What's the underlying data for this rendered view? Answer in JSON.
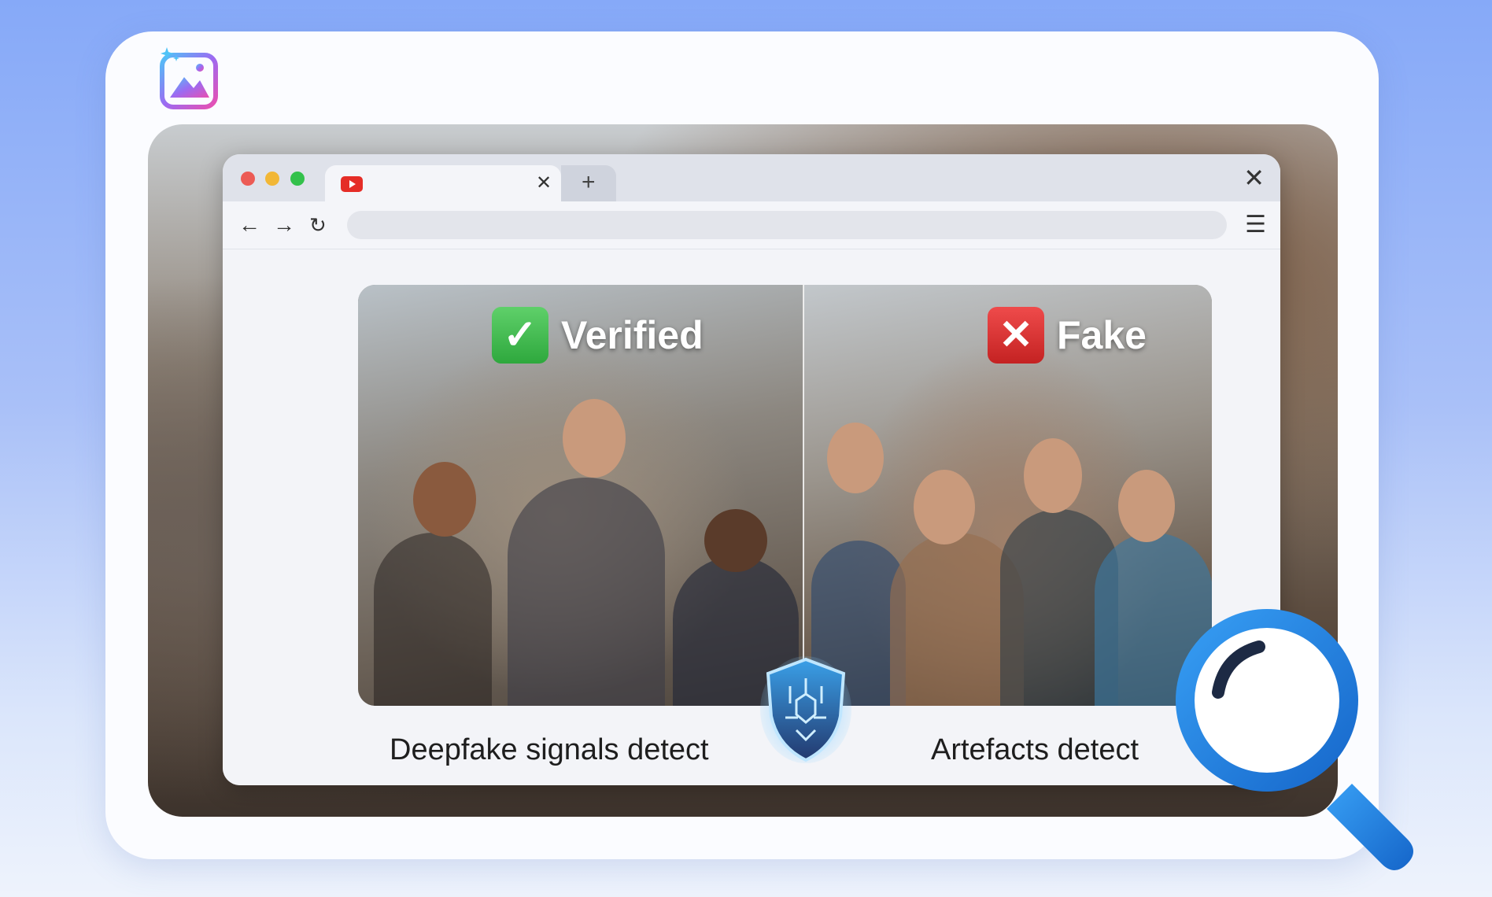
{
  "app": {
    "logo_icon": "sparkle-image-icon"
  },
  "browser": {
    "tab": {
      "favicon": "youtube-icon",
      "close_icon": "close-icon",
      "close_glyph": "✕"
    },
    "new_tab_glyph": "+",
    "window_close_glyph": "✕",
    "nav": {
      "back_glyph": "←",
      "forward_glyph": "→",
      "reload_glyph": "↻",
      "menu_glyph": "☰"
    },
    "address_bar": {
      "value": "",
      "placeholder": ""
    },
    "traffic_lights": [
      "#ec5b55",
      "#f2b736",
      "#33c14b"
    ]
  },
  "comparison": {
    "left": {
      "badge_label": "Verified",
      "badge_glyph": "✓",
      "badge_color": "#34b044",
      "caption": "Deepfake signals detect"
    },
    "right": {
      "badge_label": "Fake",
      "badge_glyph": "✕",
      "badge_color": "#d32f2f",
      "caption": "Artefacts detect"
    }
  },
  "overlays": {
    "shield_icon": "circuit-shield-icon",
    "magnifier_icon": "magnifying-glass-icon",
    "accent": "#1f7be0"
  }
}
